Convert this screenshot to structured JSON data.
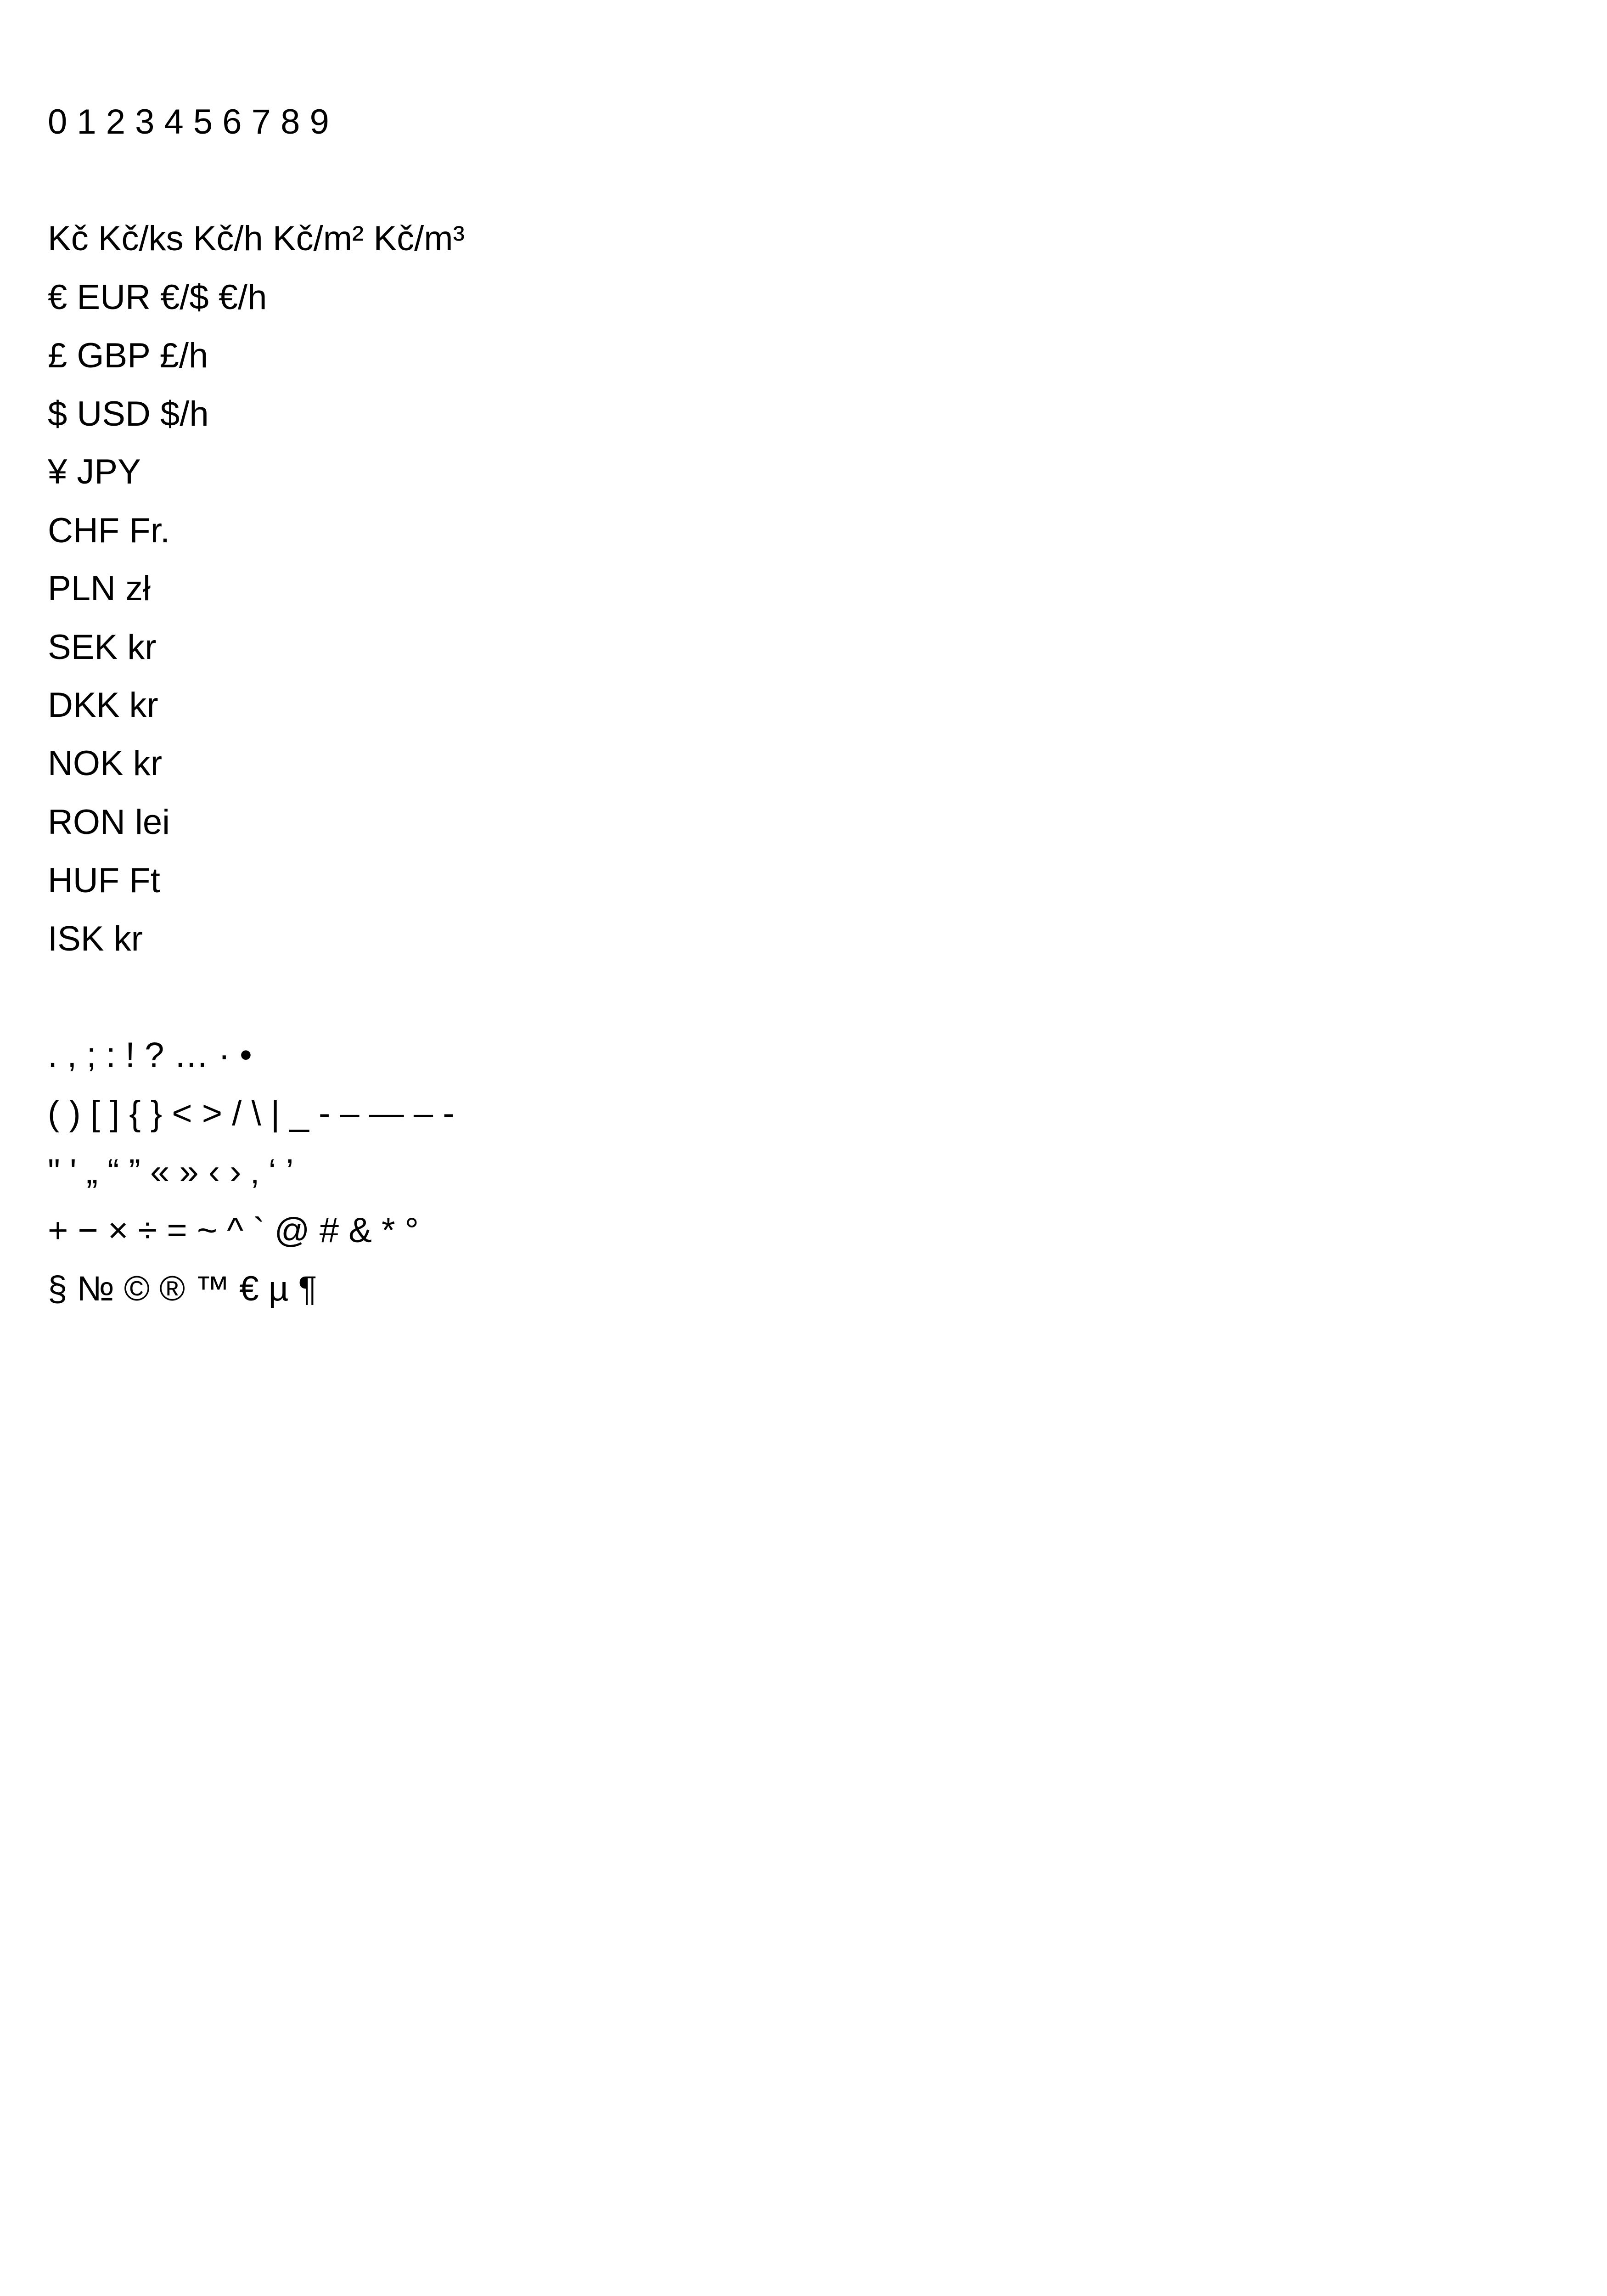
{
  "digits": "0 1 2 3 4 5 6 7 8 9",
  "currencies": [
    "Kč Kč/ks Kč/h Kč/m² Kč/m³",
    "€ EUR €/$ €/h",
    "£ GBP £/h",
    "$ USD $/h",
    "¥ JPY",
    "CHF Fr.",
    "PLN zł",
    "SEK kr",
    "DKK kr",
    "NOK kr",
    "RON lei",
    "HUF Ft",
    "ISK kr"
  ],
  "punctuation": [
    ". , ; : ! ? … · •",
    "( ) [ ] { } < > / \\ | _ - – — ‒ -",
    "\" ' „ “ ” « » ‹ › ‚ ‘ ’",
    "+ − × ÷ = ~ ^ ` @ # & * °",
    "§ № © ® ™ € µ ¶"
  ]
}
